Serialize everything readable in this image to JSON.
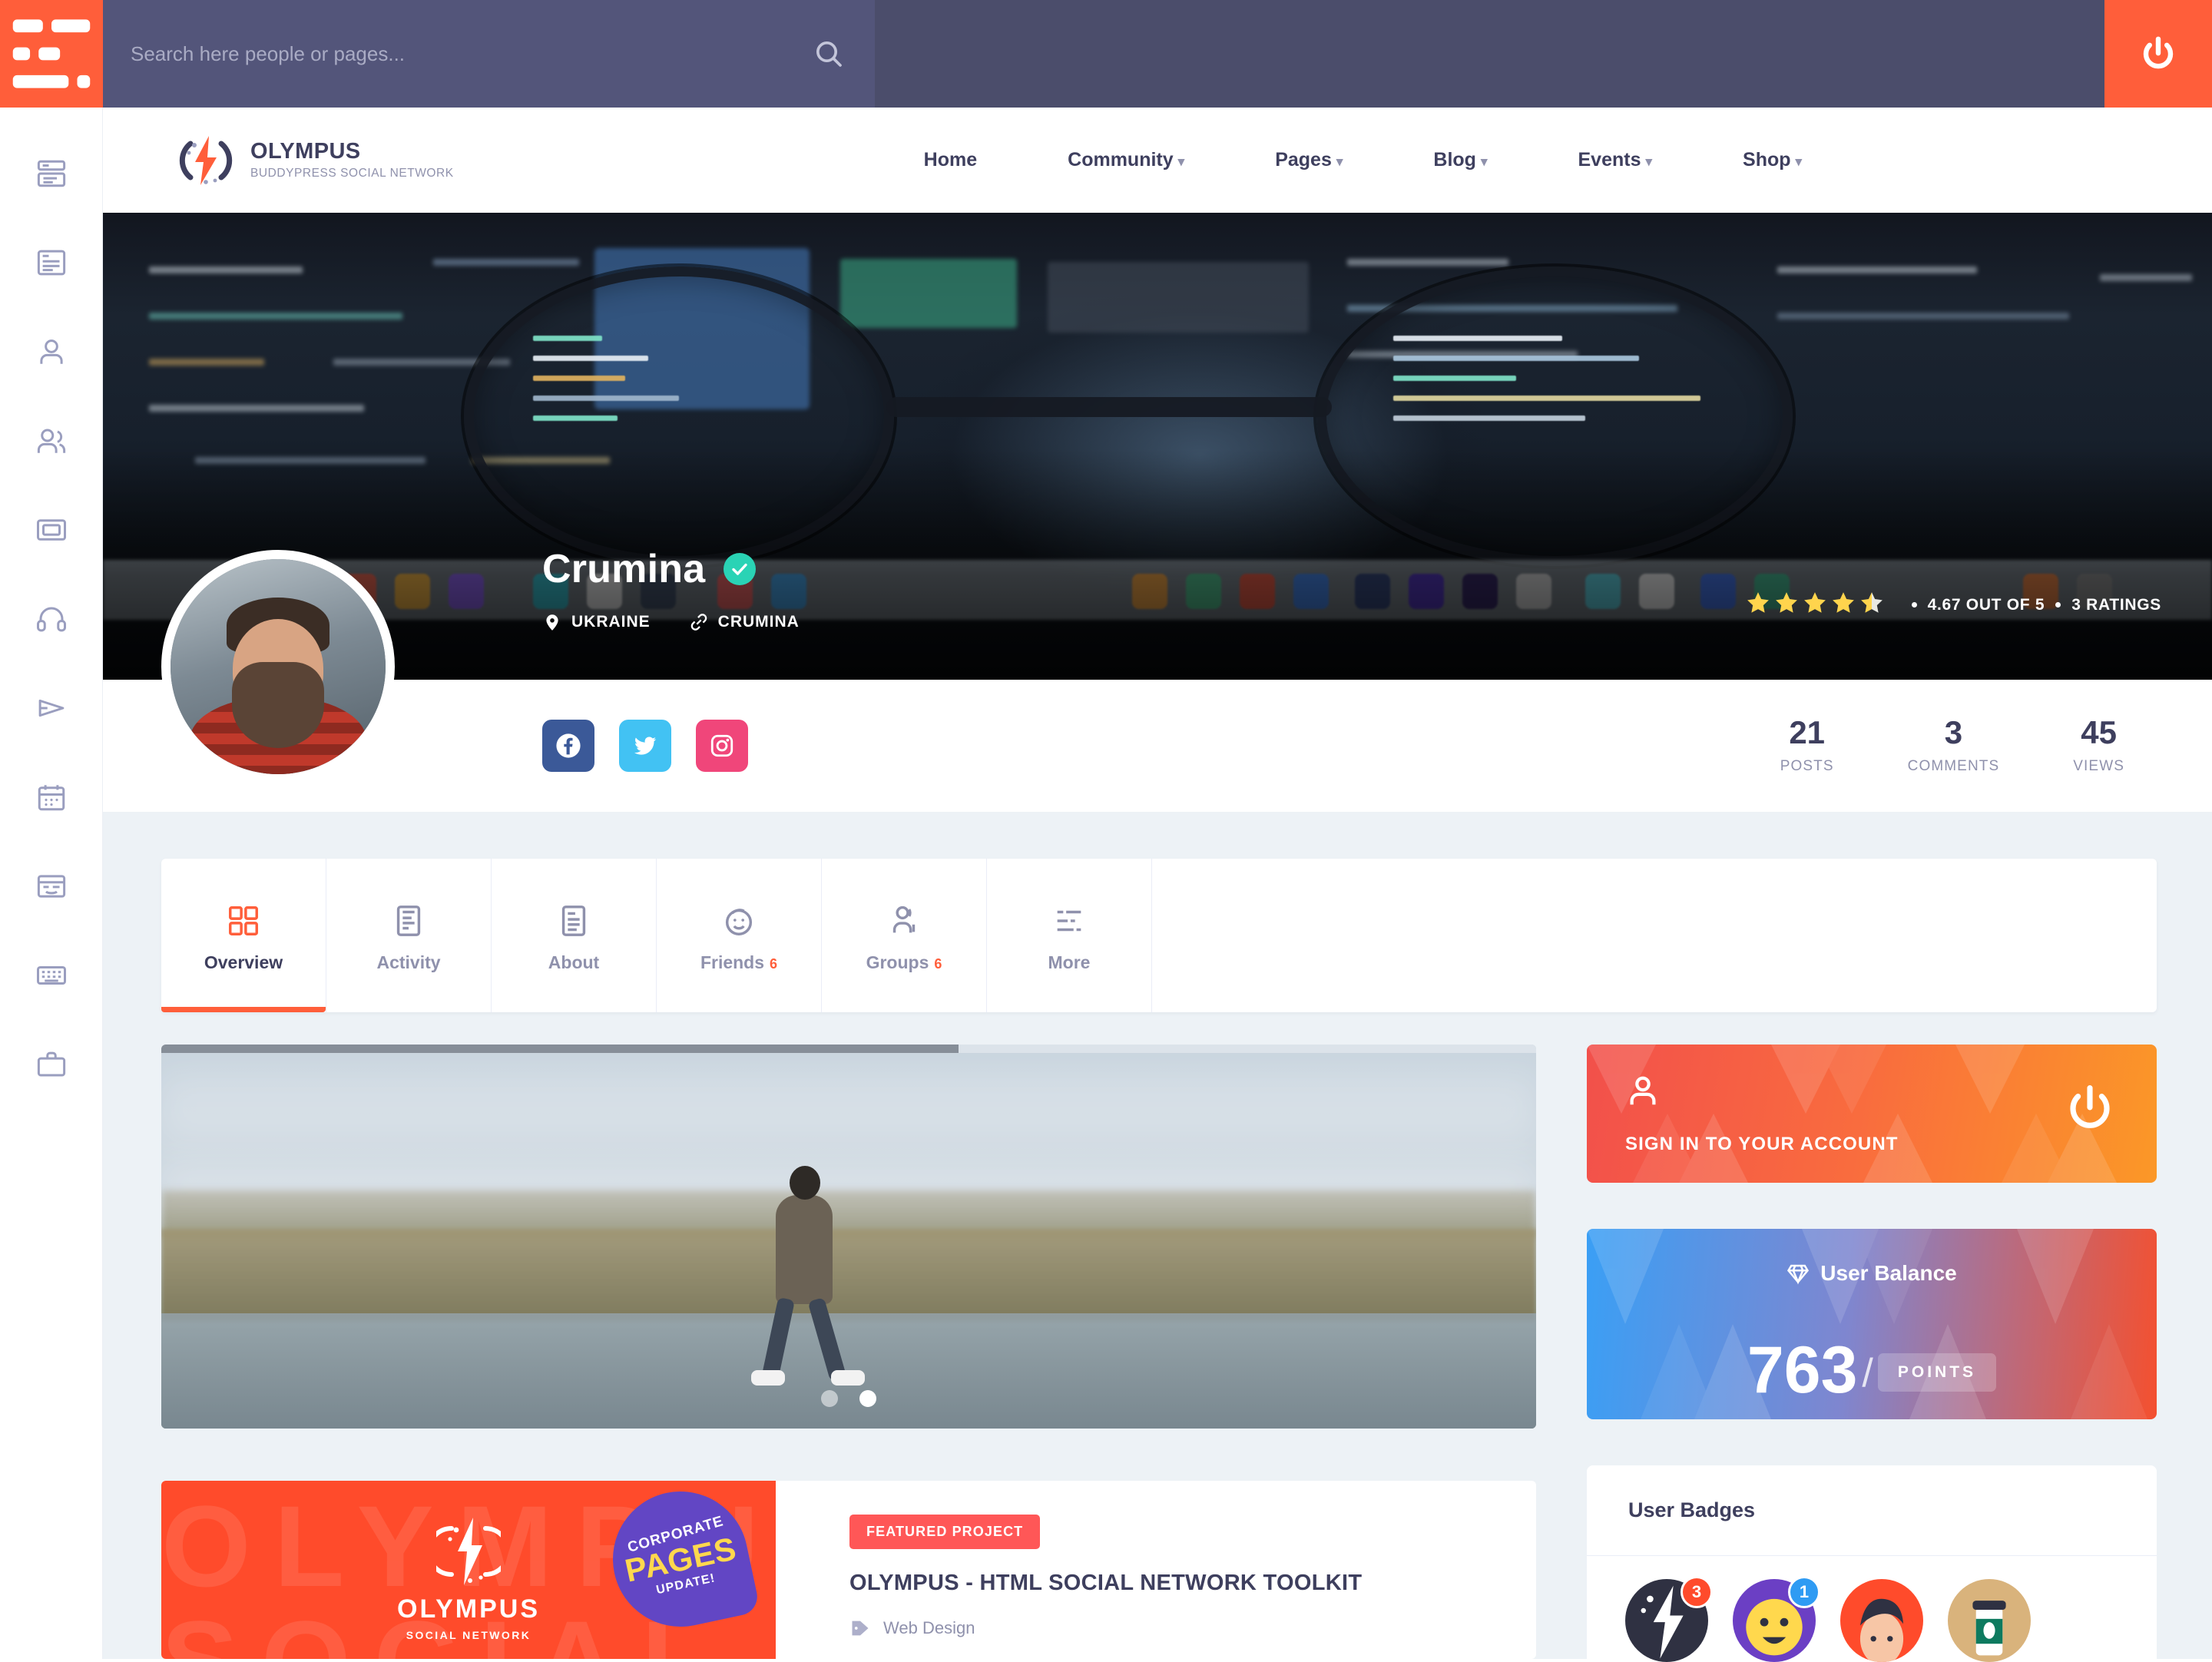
{
  "topbar": {
    "search_placeholder": "Search here people or pages...",
    "search_value": "",
    "search_icon": "search-icon",
    "power_icon": "power-icon",
    "menu_icon": "menu-lines-icon"
  },
  "rail": {
    "items": [
      {
        "name": "newsfeed",
        "icon": "newsfeed-icon"
      },
      {
        "name": "blog",
        "icon": "blog-icon"
      },
      {
        "name": "profile",
        "icon": "user-icon"
      },
      {
        "name": "friends",
        "icon": "friends-icon"
      },
      {
        "name": "photos",
        "icon": "photo-frame-icon"
      },
      {
        "name": "music",
        "icon": "headphones-icon"
      },
      {
        "name": "videos",
        "icon": "play-icon"
      },
      {
        "name": "events",
        "icon": "calendar-icon"
      },
      {
        "name": "forums",
        "icon": "forum-icon"
      },
      {
        "name": "market",
        "icon": "keyboard-icon"
      },
      {
        "name": "shop",
        "icon": "briefcase-icon"
      }
    ]
  },
  "header": {
    "logo_name": "OLYMPUS",
    "logo_sub": "BUDDYPRESS SOCIAL NETWORK",
    "nav": [
      {
        "label": "Home",
        "caret": false
      },
      {
        "label": "Community",
        "caret": true
      },
      {
        "label": "Pages",
        "caret": true
      },
      {
        "label": "Blog",
        "caret": true
      },
      {
        "label": "Events",
        "caret": true
      },
      {
        "label": "Shop",
        "caret": true
      }
    ],
    "caret_glyph": "▾"
  },
  "profile": {
    "name": "Crumina",
    "verified": true,
    "location": "UKRAINE",
    "link": "CRUMINA",
    "rating_value": "4.67 OUT OF 5",
    "rating_count": "3 RATINGS",
    "stars_full": 4,
    "stars_half": 1,
    "socials": [
      {
        "name": "facebook",
        "color": "#3b5998",
        "glyph": "f"
      },
      {
        "name": "twitter",
        "color": "#42c2f3",
        "glyph": "t"
      },
      {
        "name": "instagram",
        "color": "#f0467a",
        "glyph": "i"
      }
    ],
    "stats": [
      {
        "number": "21",
        "label": "POSTS"
      },
      {
        "number": "3",
        "label": "COMMENTS"
      },
      {
        "number": "45",
        "label": "VIEWS"
      }
    ]
  },
  "tabs": [
    {
      "label": "Overview",
      "count": "",
      "icon": "grid-icon",
      "active": true
    },
    {
      "label": "Activity",
      "count": "",
      "icon": "activity-icon",
      "active": false
    },
    {
      "label": "About",
      "count": "",
      "icon": "about-card-icon",
      "active": false
    },
    {
      "label": "Friends",
      "count": "6",
      "icon": "smiley-icon",
      "active": false
    },
    {
      "label": "Groups",
      "count": "6",
      "icon": "groups-icon",
      "active": false
    },
    {
      "label": "More",
      "count": "",
      "icon": "more-lines-icon",
      "active": false
    }
  ],
  "carousel": {
    "dots": 2,
    "active_dot": 1,
    "scroll_percent": 58
  },
  "featured": {
    "thumb_title": "OLYMPUS",
    "thumb_sub": "SOCIAL NETWORK",
    "badge_line1": "CORPORATE",
    "badge_line2": "PAGES",
    "badge_line3": "UPDATE!",
    "tag": "FEATURED PROJECT",
    "title": "OLYMPUS - HTML SOCIAL NETWORK TOOLKIT",
    "category": "Web Design",
    "category_icon": "tag-icon"
  },
  "signin": {
    "label": "SIGN IN TO YOUR ACCOUNT",
    "user_icon": "user-icon",
    "power_icon": "power-icon",
    "gradient_from": "#f2504b",
    "gradient_to": "#fb9827"
  },
  "balance": {
    "title": "User Balance",
    "icon": "diamond-icon",
    "value": "763",
    "separator": "/",
    "unit": "POINTS",
    "gradient_from": "#3a9ff5",
    "gradient_to": "#f4502f"
  },
  "badges": {
    "title": "User Badges",
    "items": [
      {
        "name": "lightning-badge",
        "count": "3",
        "count_color": "#ff4b2b",
        "bg": "#2f3142",
        "fg": "#ffffff"
      },
      {
        "name": "smiley-badge",
        "count": "1",
        "count_color": "#2f9bf3",
        "bg": "#6b3fc4",
        "fg": "#ffd84d"
      },
      {
        "name": "person-badge",
        "count": "",
        "count_color": "",
        "bg": "#ff4b2b",
        "fg": "#f7c6a6"
      },
      {
        "name": "coffee-badge",
        "count": "",
        "count_color": "",
        "bg": "#d9b37c",
        "fg": "#0e7a5f"
      }
    ]
  },
  "colors": {
    "accent": "#ff5e3a",
    "dark": "#3e3f5e",
    "muted": "#8f91ac",
    "topbar": "#4b4d6b",
    "topbar_search": "#53557a",
    "page_bg": "#edf2f6",
    "verified": "#2ad3b5",
    "star": "#ffd44d"
  }
}
